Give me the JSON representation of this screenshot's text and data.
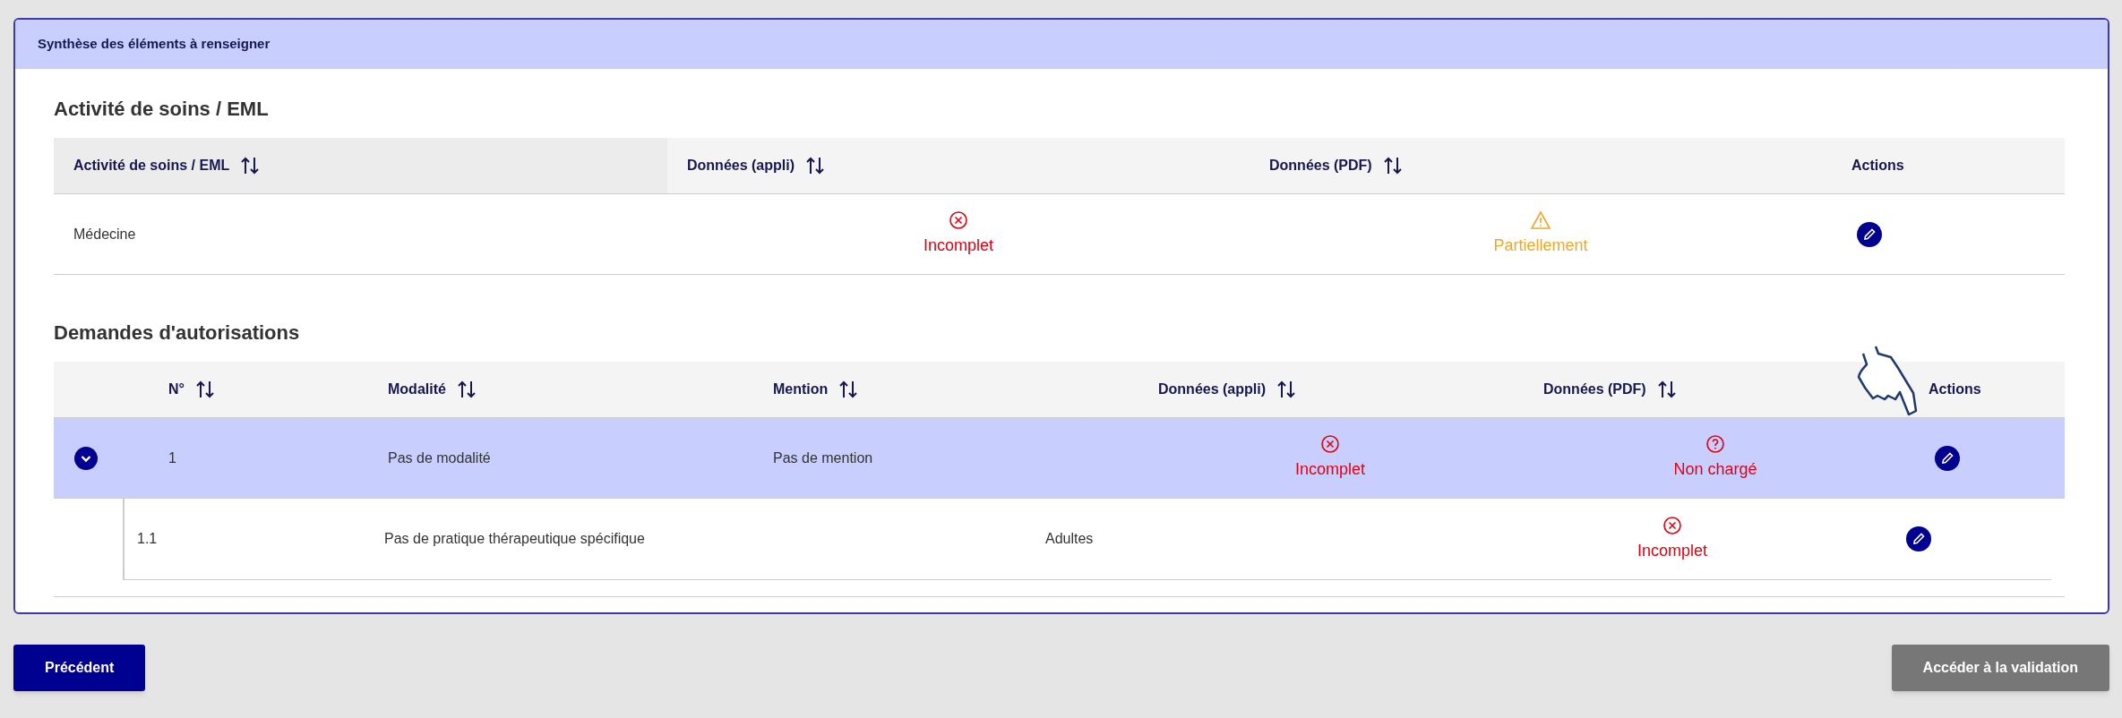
{
  "panel": {
    "title": "Synthèse des éléments à renseigner"
  },
  "activities": {
    "title": "Activité de soins / EML",
    "columns": [
      {
        "label": "Activité de soins / EML",
        "sortable": true
      },
      {
        "label": "Données (appli)",
        "sortable": true
      },
      {
        "label": "Données (PDF)",
        "sortable": true
      },
      {
        "label": "Actions",
        "sortable": false
      }
    ],
    "rows": [
      {
        "name": "Médecine",
        "data_app": {
          "kind": "incomplete",
          "label": "Incomplet"
        },
        "data_pdf": {
          "kind": "partial",
          "label": "Partiellement"
        }
      }
    ]
  },
  "requests": {
    "title": "Demandes d'autorisations",
    "columns": [
      {
        "label": "N°",
        "sortable": true
      },
      {
        "label": "Modalité",
        "sortable": true
      },
      {
        "label": "Mention",
        "sortable": true
      },
      {
        "label": "Données (appli)",
        "sortable": true
      },
      {
        "label": "Données (PDF)",
        "sortable": true
      },
      {
        "label": "Actions",
        "sortable": false
      }
    ],
    "rows": [
      {
        "number": "1",
        "modality": "Pas de modalité",
        "mention": "Pas de mention",
        "expanded": true,
        "data_app": {
          "kind": "incomplete",
          "label": "Incomplet"
        },
        "data_pdf": {
          "kind": "not_loaded",
          "label": "Non chargé"
        },
        "children": [
          {
            "number": "1.1",
            "practice": "Pas de pratique thérapeutique spécifique",
            "mention": "Adultes",
            "status": {
              "kind": "incomplete",
              "label": "Incomplet"
            }
          }
        ]
      }
    ]
  },
  "buttons": [
    {
      "label": "Précédent",
      "disabled": false
    },
    {
      "label": "Accéder à la validation",
      "disabled": true
    }
  ]
}
